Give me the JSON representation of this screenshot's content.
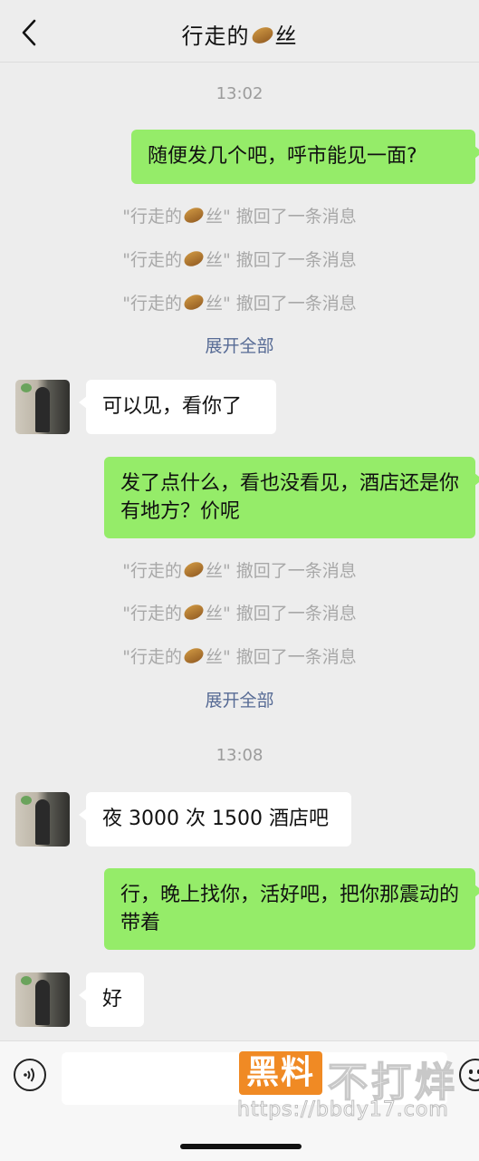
{
  "header": {
    "title_before": "行走的",
    "title_icon": "potato-emoji-icon",
    "title_after": "丝",
    "back_icon": "chevron-left-icon"
  },
  "messages": {
    "time_1": "13:02",
    "msg_1": "随便发几个吧，呼市能见一面?",
    "recall_prefix": "\"行走的",
    "recall_suffix": "丝\" 撤回了一条消息",
    "expand_all_1": "展开全部",
    "msg_2": "可以见，看你了",
    "msg_3": "发了点什么，看也没看见，酒店还是你有地方？价呢",
    "expand_all_2": "展开全部",
    "time_2": "13:08",
    "msg_4": "夜 3000 次 1500 酒店吧",
    "msg_5": "行，晚上找你，活好吧，把你那震动的带着",
    "msg_6": "好"
  },
  "input_bar": {
    "voice_icon": "voice-icon",
    "text_value": "",
    "emoji_icon": "emoji-icon"
  },
  "watermark": {
    "logo": "黑料",
    "text": "不打烊",
    "url": "https://bbdy17.com"
  },
  "colors": {
    "background": "#ededed",
    "my_bubble": "#95ec69",
    "other_bubble": "#ffffff",
    "link_blue": "#576b95",
    "watermark_orange": "#f08a24"
  }
}
